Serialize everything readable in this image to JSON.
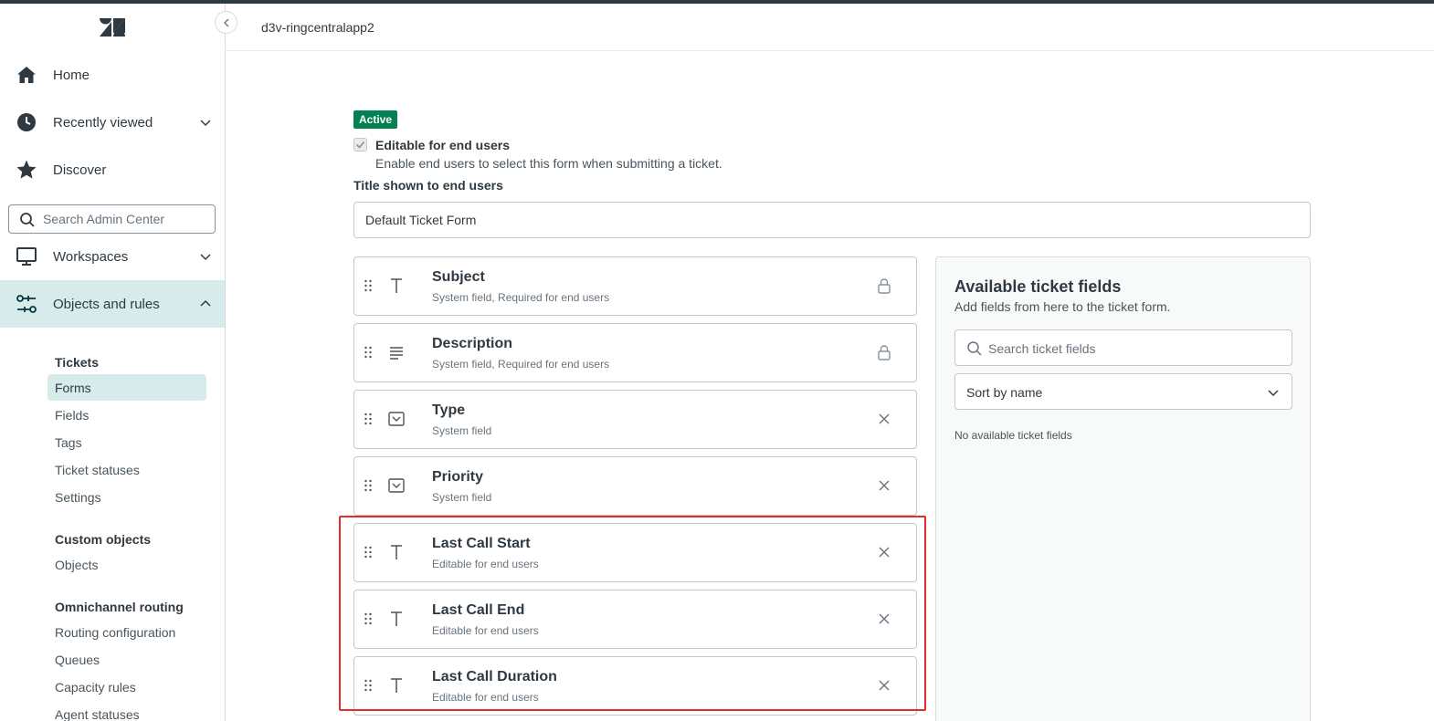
{
  "header": {
    "account": "d3v-ringcentralapp2"
  },
  "sidebar": {
    "nav": [
      {
        "label": "Home",
        "icon": "home-icon"
      },
      {
        "label": "Recently viewed",
        "icon": "clock-icon"
      },
      {
        "label": "Discover",
        "icon": "star-icon"
      },
      {
        "label": "Workspaces",
        "icon": "monitor-icon"
      },
      {
        "label": "Objects and rules",
        "icon": "objects-rules-icon"
      }
    ],
    "search_placeholder": "Search Admin Center",
    "sections": [
      {
        "heading": "Tickets",
        "items": [
          "Forms",
          "Fields",
          "Tags",
          "Ticket statuses",
          "Settings"
        ]
      },
      {
        "heading": "Custom objects",
        "items": [
          "Objects"
        ]
      },
      {
        "heading": "Omnichannel routing",
        "items": [
          "Routing configuration",
          "Queues",
          "Capacity rules",
          "Agent statuses"
        ]
      }
    ],
    "active_item": "Forms"
  },
  "form": {
    "status_badge": "Active",
    "editable_label": "Editable for end users",
    "editable_hint": "Enable end users to select this form when submitting a ticket.",
    "title_label": "Title shown to end users",
    "title_value": "Default Ticket Form",
    "fields": [
      {
        "name": "Subject",
        "desc": "System field, Required for end users",
        "type_icon": "text-type-icon",
        "action": "lock-icon"
      },
      {
        "name": "Description",
        "desc": "System field, Required for end users",
        "type_icon": "multiline-type-icon",
        "action": "lock-icon"
      },
      {
        "name": "Type",
        "desc": "System field",
        "type_icon": "dropdown-type-icon",
        "action": "close-icon"
      },
      {
        "name": "Priority",
        "desc": "System field",
        "type_icon": "dropdown-type-icon",
        "action": "close-icon"
      },
      {
        "name": "Last Call Start",
        "desc": "Editable for end users",
        "type_icon": "text-type-icon",
        "action": "close-icon"
      },
      {
        "name": "Last Call End",
        "desc": "Editable for end users",
        "type_icon": "text-type-icon",
        "action": "close-icon"
      },
      {
        "name": "Last Call Duration",
        "desc": "Editable for end users",
        "type_icon": "text-type-icon",
        "action": "close-icon"
      }
    ]
  },
  "available": {
    "title": "Available ticket fields",
    "subtitle": "Add fields from here to the ticket form.",
    "search_placeholder": "Search ticket fields",
    "sort_value": "Sort by name",
    "empty_text": "No available ticket fields"
  },
  "colors": {
    "accent": "#038153",
    "active_bg": "#d7ebeb",
    "highlight": "#e02e2e"
  }
}
